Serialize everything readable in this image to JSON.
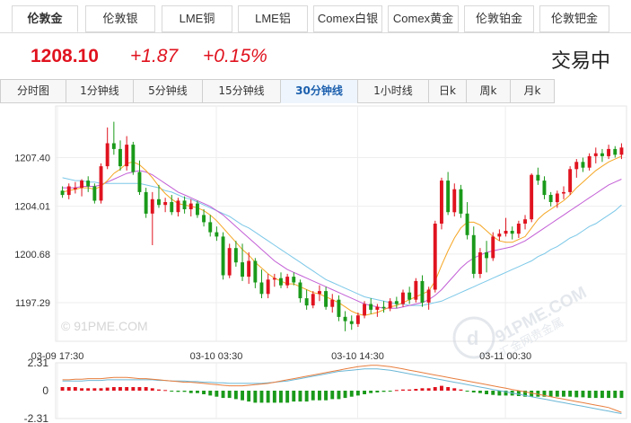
{
  "top_tabs": [
    {
      "label": "伦敦金",
      "active": true
    },
    {
      "label": "伦敦银"
    },
    {
      "label": "LME铜"
    },
    {
      "label": "LME铝"
    },
    {
      "label": "Comex白银"
    },
    {
      "label": "Comex黄金"
    },
    {
      "label": "伦敦铂金"
    },
    {
      "label": "伦敦钯金"
    }
  ],
  "quote": {
    "price": "1208.10",
    "change": "+1.87",
    "change_pct": "+0.15%",
    "status": "交易中"
  },
  "period_tabs": [
    {
      "label": "分时图"
    },
    {
      "label": "1分钟线"
    },
    {
      "label": "5分钟线"
    },
    {
      "label": "15分钟线"
    },
    {
      "label": "30分钟线",
      "active": true
    },
    {
      "label": "1小时线"
    },
    {
      "label": "日k"
    },
    {
      "label": "周k"
    },
    {
      "label": "月k"
    }
  ],
  "watermark": {
    "left_text": "© 91PME.COM",
    "logo_domain": "91PME.COM",
    "logo_cn": "汇金网贵金属"
  },
  "colors": {
    "up": "#e0131f",
    "down": "#1a9a1a",
    "ma_fast": "#f5a623",
    "ma_mid": "#c35fd6",
    "ma_slow": "#7cc8e8",
    "macd_dif": "#e87e3e",
    "macd_dea": "#6bb7d6"
  },
  "chart_data": [
    {
      "type": "candlestick",
      "y_ticks": [
        "1207.40",
        "1204.01",
        "1200.68",
        "1197.29"
      ],
      "x_ticks": [
        "03-09 17:30",
        "03-10 03:30",
        "03-10 14:30",
        "03-11 00:30"
      ],
      "ylim": [
        1194.6,
        1211.0
      ],
      "grid": true,
      "candles": [
        [
          1205.1,
          1205.4,
          1204.6,
          1204.8
        ],
        [
          1204.8,
          1205.6,
          1204.5,
          1205.4
        ],
        [
          1205.2,
          1205.7,
          1204.9,
          1205.3
        ],
        [
          1205.3,
          1205.9,
          1204.7,
          1205.8
        ],
        [
          1205.8,
          1206.1,
          1205.0,
          1205.4
        ],
        [
          1205.4,
          1205.6,
          1204.2,
          1204.4
        ],
        [
          1204.4,
          1207.0,
          1204.2,
          1206.8
        ],
        [
          1206.8,
          1209.5,
          1206.6,
          1208.4
        ],
        [
          1208.4,
          1209.9,
          1207.6,
          1208.0
        ],
        [
          1208.0,
          1208.6,
          1206.5,
          1206.8
        ],
        [
          1206.8,
          1208.9,
          1206.5,
          1208.3
        ],
        [
          1208.3,
          1208.5,
          1206.2,
          1206.4
        ],
        [
          1206.4,
          1207.2,
          1204.8,
          1205.0
        ],
        [
          1205.0,
          1205.3,
          1203.2,
          1203.5
        ],
        [
          1203.5,
          1205.0,
          1201.3,
          1204.5
        ],
        [
          1204.5,
          1205.5,
          1203.9,
          1204.1
        ],
        [
          1204.1,
          1204.6,
          1203.6,
          1204.3
        ],
        [
          1204.3,
          1204.8,
          1203.4,
          1203.6
        ],
        [
          1203.6,
          1204.6,
          1203.3,
          1204.4
        ],
        [
          1204.4,
          1204.7,
          1203.5,
          1203.8
        ],
        [
          1203.8,
          1204.5,
          1203.3,
          1204.2
        ],
        [
          1204.2,
          1204.4,
          1203.2,
          1203.4
        ],
        [
          1203.4,
          1203.8,
          1202.6,
          1202.9
        ],
        [
          1202.9,
          1203.4,
          1201.9,
          1202.2
        ],
        [
          1202.2,
          1202.6,
          1201.6,
          1201.9
        ],
        [
          1201.9,
          1202.2,
          1198.9,
          1199.2
        ],
        [
          1199.2,
          1201.4,
          1199.0,
          1201.1
        ],
        [
          1201.1,
          1201.6,
          1199.8,
          1200.1
        ],
        [
          1200.1,
          1201.4,
          1198.8,
          1199.1
        ],
        [
          1199.1,
          1200.8,
          1198.6,
          1200.2
        ],
        [
          1200.2,
          1200.4,
          1198.3,
          1198.7
        ],
        [
          1198.7,
          1199.6,
          1197.6,
          1197.9
        ],
        [
          1197.9,
          1199.3,
          1197.6,
          1198.9
        ],
        [
          1198.9,
          1199.3,
          1198.4,
          1199.0
        ],
        [
          1199.0,
          1199.4,
          1198.3,
          1198.5
        ],
        [
          1198.5,
          1199.3,
          1198.3,
          1199.1
        ],
        [
          1199.1,
          1199.4,
          1198.5,
          1198.7
        ],
        [
          1198.7,
          1198.9,
          1197.3,
          1197.6
        ],
        [
          1197.6,
          1198.2,
          1196.8,
          1197.1
        ],
        [
          1197.1,
          1198.1,
          1196.9,
          1197.9
        ],
        [
          1197.9,
          1198.5,
          1197.4,
          1198.1
        ],
        [
          1198.1,
          1198.4,
          1196.8,
          1197.0
        ],
        [
          1197.0,
          1197.9,
          1196.6,
          1197.5
        ],
        [
          1197.5,
          1197.8,
          1196.0,
          1196.3
        ],
        [
          1196.3,
          1196.7,
          1195.3,
          1196.0
        ],
        [
          1196.0,
          1196.4,
          1195.4,
          1195.8
        ],
        [
          1195.8,
          1196.6,
          1195.6,
          1196.4
        ],
        [
          1196.4,
          1197.4,
          1196.2,
          1197.2
        ],
        [
          1197.2,
          1197.6,
          1196.5,
          1196.8
        ],
        [
          1196.8,
          1197.2,
          1196.3,
          1197.0
        ],
        [
          1197.0,
          1197.4,
          1196.6,
          1196.9
        ],
        [
          1196.9,
          1197.6,
          1196.7,
          1197.4
        ],
        [
          1197.4,
          1197.7,
          1196.9,
          1197.2
        ],
        [
          1197.2,
          1198.2,
          1197.0,
          1198.0
        ],
        [
          1198.0,
          1198.4,
          1197.2,
          1197.5
        ],
        [
          1197.5,
          1199.0,
          1197.3,
          1198.8
        ],
        [
          1198.8,
          1199.2,
          1197.0,
          1197.3
        ],
        [
          1197.3,
          1198.4,
          1196.8,
          1198.2
        ],
        [
          1198.2,
          1203.0,
          1198.0,
          1202.8
        ],
        [
          1202.8,
          1206.0,
          1202.4,
          1205.8
        ],
        [
          1205.8,
          1206.4,
          1203.4,
          1203.6
        ],
        [
          1203.6,
          1205.6,
          1203.3,
          1205.2
        ],
        [
          1205.2,
          1205.5,
          1203.2,
          1203.5
        ],
        [
          1203.5,
          1204.3,
          1201.7,
          1202.0
        ],
        [
          1202.0,
          1202.6,
          1199.0,
          1199.3
        ],
        [
          1199.3,
          1201.1,
          1199.0,
          1200.8
        ],
        [
          1200.8,
          1201.6,
          1199.4,
          1200.4
        ],
        [
          1200.4,
          1202.2,
          1200.2,
          1201.9
        ],
        [
          1201.9,
          1202.4,
          1201.6,
          1202.1
        ],
        [
          1202.1,
          1203.2,
          1201.9,
          1202.3
        ],
        [
          1202.3,
          1202.6,
          1201.7,
          1202.1
        ],
        [
          1202.1,
          1203.0,
          1201.8,
          1202.8
        ],
        [
          1202.8,
          1203.4,
          1202.4,
          1203.1
        ],
        [
          1203.1,
          1206.3,
          1202.9,
          1206.2
        ],
        [
          1206.2,
          1206.7,
          1205.5,
          1205.8
        ],
        [
          1205.8,
          1206.1,
          1204.5,
          1204.8
        ],
        [
          1204.8,
          1205.0,
          1204.0,
          1204.3
        ],
        [
          1204.3,
          1205.1,
          1203.9,
          1204.9
        ],
        [
          1204.9,
          1205.4,
          1204.5,
          1205.0
        ],
        [
          1205.0,
          1206.8,
          1204.8,
          1206.6
        ],
        [
          1206.6,
          1207.3,
          1206.0,
          1207.1
        ],
        [
          1207.1,
          1207.4,
          1206.4,
          1206.7
        ],
        [
          1206.7,
          1207.7,
          1206.5,
          1207.5
        ],
        [
          1207.5,
          1208.1,
          1207.0,
          1207.7
        ],
        [
          1207.7,
          1208.0,
          1207.1,
          1207.5
        ],
        [
          1207.5,
          1208.3,
          1207.3,
          1208.0
        ],
        [
          1208.0,
          1208.2,
          1207.4,
          1207.6
        ],
        [
          1207.6,
          1208.4,
          1207.3,
          1208.1
        ]
      ],
      "ma_fast": [
        1205.0,
        1205.1,
        1205.2,
        1205.3,
        1205.3,
        1205.2,
        1205.4,
        1205.8,
        1206.3,
        1206.6,
        1207.0,
        1207.1,
        1206.9,
        1206.5,
        1206.0,
        1205.4,
        1204.9,
        1204.5,
        1204.2,
        1204.1,
        1204.0,
        1203.9,
        1203.7,
        1203.4,
        1203.0,
        1202.5,
        1202.0,
        1201.5,
        1201.0,
        1200.6,
        1200.1,
        1199.7,
        1199.3,
        1199.0,
        1198.8,
        1198.6,
        1198.6,
        1198.4,
        1198.2,
        1198.0,
        1197.9,
        1197.7,
        1197.5,
        1197.3,
        1197.0,
        1196.7,
        1196.5,
        1196.4,
        1196.5,
        1196.6,
        1196.8,
        1197.0,
        1197.1,
        1197.3,
        1197.5,
        1197.7,
        1197.9,
        1198.1,
        1198.8,
        1199.9,
        1200.9,
        1201.8,
        1202.5,
        1202.9,
        1202.9,
        1202.7,
        1202.3,
        1201.9,
        1201.6,
        1201.5,
        1201.5,
        1201.7,
        1201.9,
        1202.5,
        1203.1,
        1203.5,
        1203.8,
        1204.1,
        1204.4,
        1204.8,
        1205.3,
        1205.7,
        1206.1,
        1206.5,
        1206.8,
        1207.1,
        1207.3,
        1207.5
      ],
      "ma_mid": [
        1205.3,
        1205.3,
        1205.3,
        1205.4,
        1205.4,
        1205.4,
        1205.5,
        1205.7,
        1205.9,
        1206.1,
        1206.3,
        1206.4,
        1206.5,
        1206.4,
        1206.2,
        1205.9,
        1205.6,
        1205.3,
        1205.0,
        1204.8,
        1204.6,
        1204.4,
        1204.2,
        1204.0,
        1203.7,
        1203.4,
        1203.0,
        1202.6,
        1202.2,
        1201.8,
        1201.4,
        1201.0,
        1200.6,
        1200.2,
        1199.9,
        1199.6,
        1199.4,
        1199.2,
        1199.0,
        1198.8,
        1198.6,
        1198.4,
        1198.2,
        1198.0,
        1197.8,
        1197.6,
        1197.4,
        1197.2,
        1197.1,
        1197.0,
        1196.9,
        1196.9,
        1196.9,
        1197.0,
        1197.1,
        1197.2,
        1197.3,
        1197.5,
        1197.8,
        1198.2,
        1198.7,
        1199.2,
        1199.7,
        1200.1,
        1200.4,
        1200.6,
        1200.8,
        1200.9,
        1201.0,
        1201.1,
        1201.2,
        1201.4,
        1201.6,
        1201.9,
        1202.2,
        1202.5,
        1202.8,
        1203.1,
        1203.4,
        1203.7,
        1204.0,
        1204.3,
        1204.6,
        1204.9,
        1205.2,
        1205.5,
        1205.7,
        1205.9
      ],
      "ma_slow": [
        1206.0,
        1205.9,
        1205.8,
        1205.8,
        1205.7,
        1205.7,
        1205.6,
        1205.6,
        1205.6,
        1205.6,
        1205.6,
        1205.6,
        1205.6,
        1205.5,
        1205.4,
        1205.3,
        1205.1,
        1205.0,
        1204.8,
        1204.6,
        1204.5,
        1204.3,
        1204.1,
        1203.9,
        1203.7,
        1203.5,
        1203.3,
        1203.0,
        1202.7,
        1202.5,
        1202.2,
        1201.9,
        1201.6,
        1201.3,
        1201.0,
        1200.7,
        1200.4,
        1200.1,
        1199.8,
        1199.5,
        1199.2,
        1198.9,
        1198.7,
        1198.5,
        1198.3,
        1198.1,
        1197.9,
        1197.7,
        1197.6,
        1197.5,
        1197.4,
        1197.3,
        1197.2,
        1197.2,
        1197.1,
        1197.1,
        1197.1,
        1197.2,
        1197.3,
        1197.4,
        1197.6,
        1197.8,
        1198.0,
        1198.2,
        1198.4,
        1198.6,
        1198.8,
        1199.0,
        1199.2,
        1199.4,
        1199.6,
        1199.8,
        1200.0,
        1200.2,
        1200.5,
        1200.7,
        1201.0,
        1201.2,
        1201.5,
        1201.8,
        1202.0,
        1202.3,
        1202.6,
        1202.8,
        1203.1,
        1203.4,
        1203.7,
        1204.1
      ]
    },
    {
      "type": "macd",
      "y_ticks": [
        "2.31",
        "0",
        "-2.31"
      ],
      "ylim": [
        -2.31,
        2.31
      ],
      "hist": [
        0.3,
        0.3,
        0.3,
        0.2,
        0.2,
        0.2,
        0.2,
        0.25,
        0.3,
        0.3,
        0.3,
        0.3,
        0.3,
        0.3,
        0.2,
        0.1,
        0.05,
        -0.05,
        -0.1,
        -0.1,
        -0.2,
        -0.2,
        -0.3,
        -0.4,
        -0.5,
        -0.6,
        -0.6,
        -0.7,
        -0.8,
        -0.9,
        -1.0,
        -1.0,
        -1.0,
        -1.0,
        -1.0,
        -1.0,
        -0.9,
        -0.9,
        -0.9,
        -0.8,
        -0.8,
        -0.8,
        -0.7,
        -0.7,
        -0.6,
        -0.5,
        -0.4,
        -0.3,
        -0.2,
        -0.15,
        -0.1,
        -0.05,
        0.05,
        0.1,
        0.1,
        0.15,
        0.2,
        0.2,
        0.3,
        0.4,
        0.3,
        0.2,
        0.1,
        -0.05,
        -0.15,
        -0.2,
        -0.3,
        -0.35,
        -0.4,
        -0.4,
        -0.4,
        -0.45,
        -0.5,
        -0.5,
        -0.5,
        -0.5,
        -0.5,
        -0.5,
        -0.5,
        -0.5,
        -0.55,
        -0.55,
        -0.6,
        -0.6,
        -0.6,
        -0.6,
        -0.6,
        -0.6
      ],
      "dif": [
        0.9,
        0.9,
        0.95,
        0.95,
        1.0,
        1.0,
        1.0,
        1.05,
        1.1,
        1.1,
        1.1,
        1.05,
        1.0,
        1.0,
        0.95,
        0.9,
        0.85,
        0.8,
        0.75,
        0.7,
        0.7,
        0.65,
        0.6,
        0.55,
        0.5,
        0.45,
        0.4,
        0.4,
        0.4,
        0.45,
        0.5,
        0.55,
        0.6,
        0.7,
        0.8,
        0.9,
        1.0,
        1.1,
        1.2,
        1.3,
        1.4,
        1.5,
        1.6,
        1.7,
        1.8,
        1.9,
        2.0,
        2.05,
        2.1,
        2.1,
        2.05,
        2.0,
        1.9,
        1.8,
        1.7,
        1.6,
        1.5,
        1.4,
        1.3,
        1.2,
        1.1,
        1.0,
        0.9,
        0.8,
        0.7,
        0.6,
        0.5,
        0.4,
        0.3,
        0.2,
        0.1,
        0.0,
        -0.1,
        -0.2,
        -0.3,
        -0.4,
        -0.5,
        -0.6,
        -0.7,
        -0.8,
        -0.9,
        -1.0,
        -1.1,
        -1.2,
        -1.3,
        -1.4,
        -1.6,
        -1.8
      ],
      "dea": [
        0.8,
        0.8,
        0.8,
        0.8,
        0.85,
        0.85,
        0.85,
        0.9,
        0.9,
        0.9,
        0.9,
        0.9,
        0.9,
        0.9,
        0.9,
        0.85,
        0.85,
        0.8,
        0.8,
        0.8,
        0.75,
        0.75,
        0.7,
        0.7,
        0.65,
        0.65,
        0.6,
        0.6,
        0.6,
        0.6,
        0.6,
        0.6,
        0.65,
        0.7,
        0.75,
        0.8,
        0.9,
        1.0,
        1.1,
        1.2,
        1.3,
        1.4,
        1.5,
        1.6,
        1.65,
        1.7,
        1.75,
        1.8,
        1.8,
        1.8,
        1.75,
        1.7,
        1.6,
        1.5,
        1.4,
        1.3,
        1.2,
        1.1,
        1.0,
        0.9,
        0.8,
        0.7,
        0.6,
        0.5,
        0.4,
        0.3,
        0.2,
        0.1,
        0.0,
        -0.1,
        -0.2,
        -0.3,
        -0.4,
        -0.5,
        -0.6,
        -0.7,
        -0.8,
        -0.9,
        -1.0,
        -1.1,
        -1.2,
        -1.3,
        -1.4,
        -1.5,
        -1.6,
        -1.7,
        -1.8,
        -1.9
      ]
    }
  ]
}
